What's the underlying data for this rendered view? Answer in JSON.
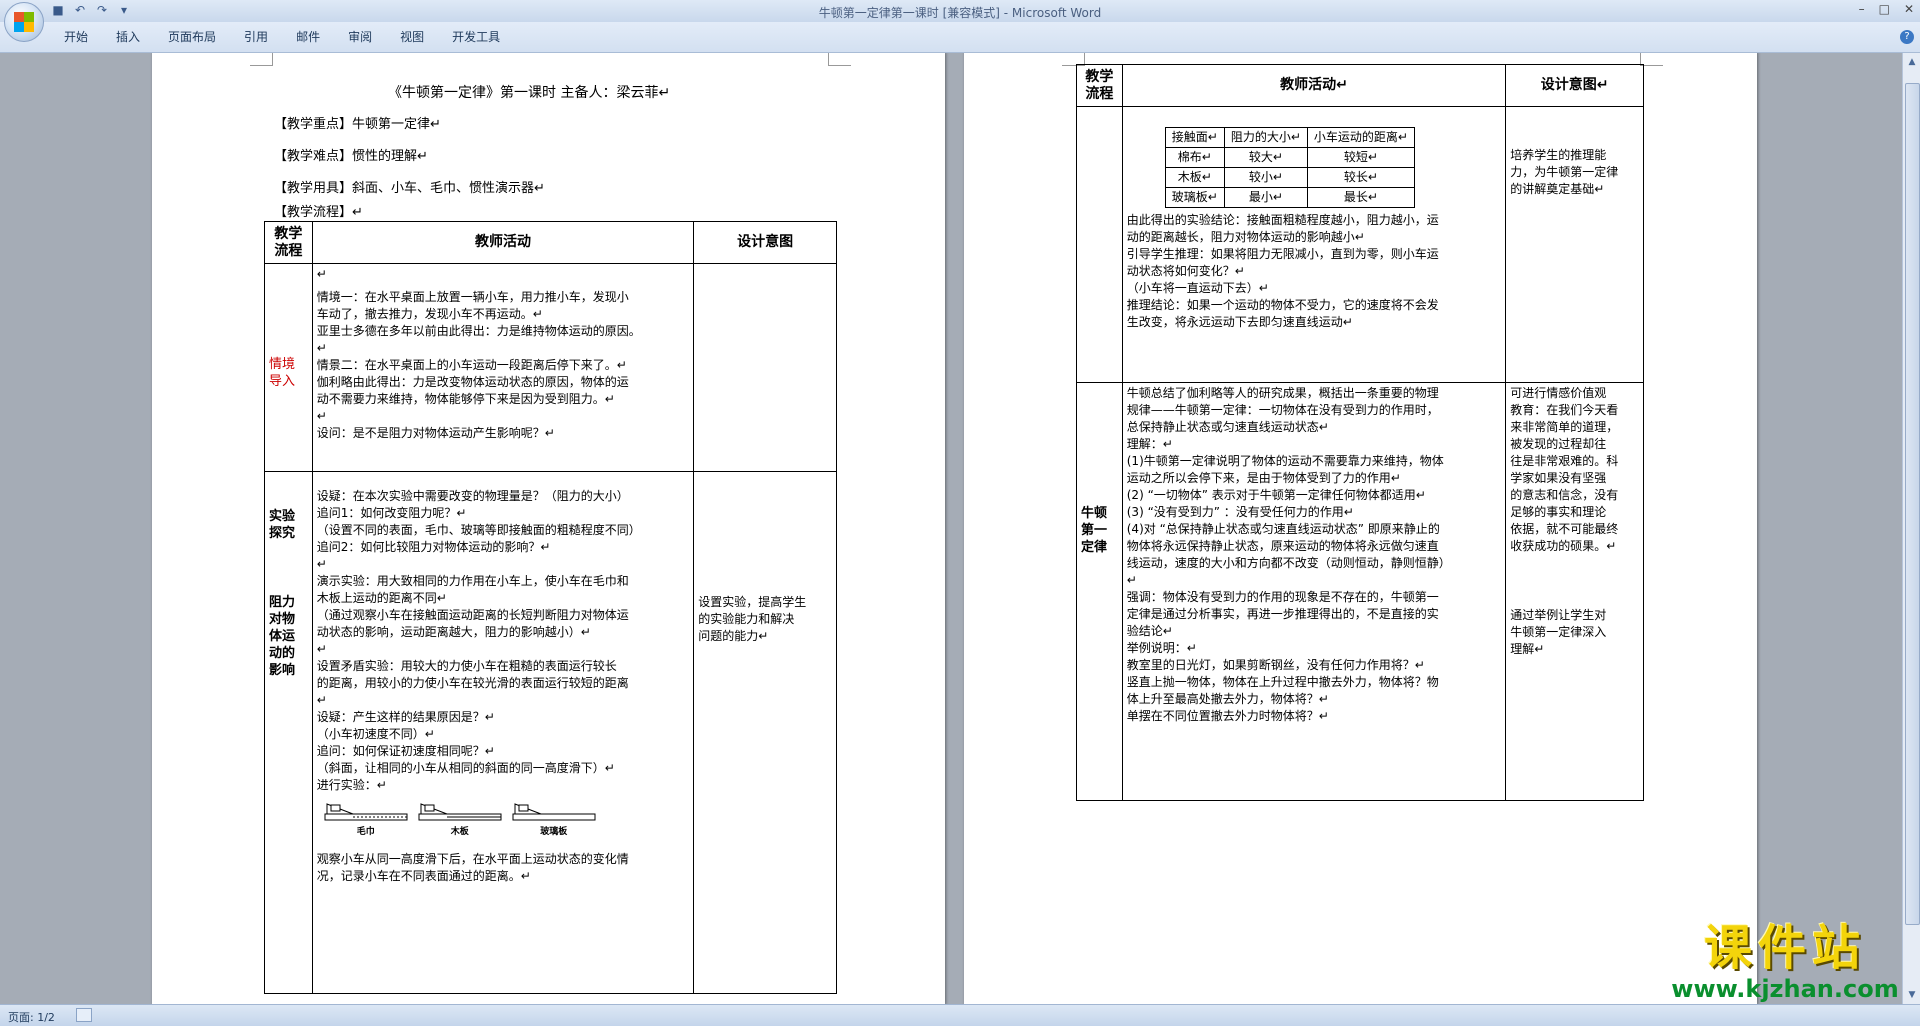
{
  "window": {
    "title": "牛顿第一定律第一课时 [兼容模式] - Microsoft Word",
    "controls": [
      "–",
      "□",
      "✕"
    ]
  },
  "ribbon": {
    "tabs": [
      "开始",
      "插入",
      "页面布局",
      "引用",
      "邮件",
      "审阅",
      "视图",
      "开发工具"
    ]
  },
  "quick_access": {
    "icons": [
      "save-icon",
      "undo-icon",
      "redo-icon",
      "customize-icon"
    ]
  },
  "page1": {
    "title": "《牛顿第一定律》第一课时    主备人：梁云菲↵",
    "key_point": "【教学重点】牛顿第一定律↵",
    "difficulty": "【教学难点】惯性的理解↵",
    "tools": "【教学用具】斜面、小车、毛巾、惯性演示器↵",
    "flow": "【教学流程】↵",
    "headers": {
      "col1_a": "教学",
      "col1_b": "流程",
      "col2": "教师活动",
      "col3": "设计意图"
    },
    "row1": {
      "stage_a": "情境",
      "stage_b": "导入",
      "lines": [
        "↵",
        "情境一：在水平桌面上放置一辆小车，用力推小车，发现小",
        "车动了，撤去推力，发现小车不再运动。↵",
        "亚里士多德在多年以前由此得出：力是维持物体运动的原因。",
        "↵",
        "情景二：在水平桌面上的小车运动一段距离后停下来了。↵",
        "伽利略由此得出：力是改变物体运动状态的原因，物体的运",
        "动不需要力来维持，物体能够停下来是因为受到阻力。↵",
        "↵",
        "设问：是不是阻力对物体运动产生影响呢？↵"
      ]
    },
    "row2": {
      "stage1_a": "实验",
      "stage1_b": "探究",
      "stage2": [
        "阻力",
        "对物",
        "体运",
        "动的",
        "影响"
      ],
      "lines_a": [
        "设疑：在本次实验中需要改变的物理量是？（阻力的大小）",
        "追问1：如何改变阻力呢？↵",
        "（设置不同的表面，毛巾、玻璃等即接触面的粗糙程度不同）",
        "追问2：如何比较阻力对物体运动的影响？↵",
        "↵",
        "演示实验：用大致相同的力作用在小车上，使小车在毛巾和",
        "木板上运动的距离不同↵",
        "（通过观察小车在接触面运动距离的长短判断阻力对物体运",
        "动状态的影响，运动距离越大，阻力的影响越小）↵",
        "↵",
        "设置矛盾实验：用较大的力使小车在粗糙的表面运行较长",
        "的距离，用较小的力使小车在较光滑的表面运行较短的距离",
        "↵",
        "设疑：产生这样的结果原因是？↵",
        "（小车初速度不同）↵",
        "追问：如何保证初速度相同呢？↵",
        "（斜面，让相同的小车从相同的斜面的同一高度滑下）↵",
        "进行实验：↵"
      ],
      "apparatus": [
        "毛巾",
        "木板",
        "玻璃板"
      ],
      "lines_b": [
        "观察小车从同一高度滑下后，在水平面上运动状态的变化情",
        "况，记录小车在不同表面通过的距离。↵"
      ],
      "intent": [
        "设置实验，提高学生",
        "的实验能力和解决",
        "问题的能力↵"
      ]
    }
  },
  "page2": {
    "headers": {
      "col1_a": "教学",
      "col1_b": "流程",
      "col2": "教师活动↵",
      "col3": "设计意图↵"
    },
    "inner_table": {
      "header": [
        "接触面↵",
        "阻力的大小↵",
        "小车运动的距离↵"
      ],
      "rows": [
        [
          "棉布↵",
          "较大↵",
          "较短↵"
        ],
        [
          "木板↵",
          "较小↵",
          "较长↵"
        ],
        [
          "玻璃板↵",
          "最小↵",
          "最长↵"
        ]
      ]
    },
    "row1": {
      "lines": [
        "由此得出的实验结论：接触面粗糙程度越小，阻力越小，运",
        "动的距离越长，阻力对物体运动的影响越小↵",
        "引导学生推理：如果将阻力无限减小，直到为零，则小车运",
        "动状态将如何变化？↵",
        "（小车将一直运动下去）↵",
        "推理结论：如果一个运动的物体不受力，它的速度将不会发",
        "生改变，将永远运动下去即匀速直线运动↵"
      ],
      "intent": [
        "培养学生的推理能",
        "力，为牛顿第一定律",
        "的讲解奠定基础↵"
      ]
    },
    "row2": {
      "stage": [
        "牛顿",
        "第一",
        "定律"
      ],
      "lines": [
        "牛顿总结了伽利略等人的研究成果，概括出一条重要的物理",
        "规律——牛顿第一定律：一切物体在没有受到力的作用时，",
        "总保持静止状态或匀速直线运动状态↵",
        "理解：↵",
        "(1)牛顿第一定律说明了物体的运动不需要靠力来维持，物体",
        "运动之所以会停下来，是由于物体受到了力的作用↵",
        "(2) “一切物体” 表示对于牛顿第一定律任何物体都适用↵",
        "(3) “没有受到力” ：没有受任何力的作用↵",
        "(4)对 “总保持静止状态或匀速直线运动状态” 即原来静止的",
        "物体将永远保持静止状态，原来运动的物体将永远做匀速直",
        "线运动，速度的大小和方向都不改变（动则恒动，静则恒静）",
        "↵",
        "强调：物体没有受到力的作用的现象是不存在的，牛顿第一",
        "定律是通过分析事实，再进一步推理得出的，不是直接的实",
        "验结论↵",
        "举例说明：↵",
        "教室里的日光灯，如果剪断钢丝，没有任何力作用将？↵",
        "竖直上抛一物体，物体在上升过程中撤去外力，物体将？物",
        "体上升至最高处撤去外力，物体将？↵",
        "单摆在不同位置撤去外力时物体将？↵"
      ],
      "intent_a": [
        "可进行情感价值观",
        "教育：在我们今天看",
        "来非常简单的道理，",
        "被发现的过程却往",
        "往是非常艰难的。科",
        "学家如果没有坚强",
        "的意志和信念，没有",
        "足够的事实和理论",
        "依据，就不可能最终",
        "收获成功的硕果。↵"
      ],
      "intent_b": [
        "通过举例让学生对",
        "牛顿第一定律深入",
        "理解↵"
      ]
    }
  },
  "status": {
    "page": "页面: 1/2"
  },
  "watermark": {
    "title": "课件站",
    "url": "www.kjzhan.com"
  }
}
